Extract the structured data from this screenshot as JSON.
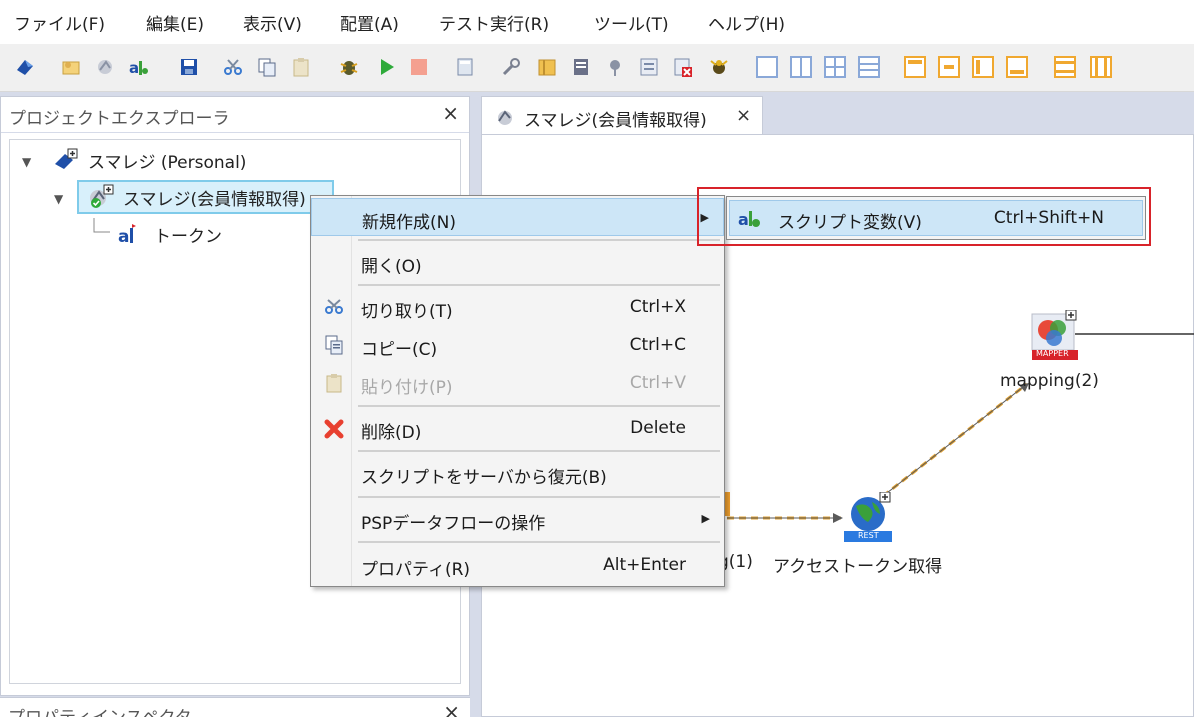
{
  "menubar": {
    "items": [
      "ファイル(F)",
      "編集(E)",
      "表示(V)",
      "配置(A)",
      "テスト実行(R)",
      "ツール(T)",
      "ヘルプ(H)"
    ]
  },
  "left_panel": {
    "title": "プロジェクトエクスプローラ",
    "close": "×",
    "tree": {
      "root": "スマレジ (Personal)",
      "child": "スマレジ(会員情報取得)",
      "leaf": "トークン"
    }
  },
  "bottom_panel": {
    "title": "プロパティインスペクタ",
    "close": "×"
  },
  "editor": {
    "tab_label": "スマレジ(会員情報取得)",
    "tab_close": "×",
    "nodes": {
      "mapping2": "mapping(2)",
      "mapping1_partial": "g(1)",
      "access_token": "アクセストークン取得",
      "mapper_badge": "MAPPER",
      "rest_badge": "REST"
    }
  },
  "context_menu": {
    "items": [
      {
        "label": "新規作成(N)",
        "shortcut": "",
        "submenu": true,
        "highlighted": true,
        "disabled": false
      },
      {
        "label": "開く(O)",
        "shortcut": "",
        "submenu": false,
        "highlighted": false,
        "disabled": false
      },
      {
        "label": "切り取り(T)",
        "shortcut": "Ctrl+X",
        "submenu": false,
        "highlighted": false,
        "disabled": false,
        "icon": "scissors-icon"
      },
      {
        "label": "コピー(C)",
        "shortcut": "Ctrl+C",
        "submenu": false,
        "highlighted": false,
        "disabled": false,
        "icon": "copy-icon"
      },
      {
        "label": "貼り付け(P)",
        "shortcut": "Ctrl+V",
        "submenu": false,
        "highlighted": false,
        "disabled": true,
        "icon": "paste-icon"
      },
      {
        "label": "削除(D)",
        "shortcut": "Delete",
        "submenu": false,
        "highlighted": false,
        "disabled": false,
        "icon": "delete-icon"
      },
      {
        "label": "スクリプトをサーバから復元(B)",
        "shortcut": "",
        "submenu": false,
        "highlighted": false,
        "disabled": false
      },
      {
        "label": "PSPデータフローの操作",
        "shortcut": "",
        "submenu": true,
        "highlighted": false,
        "disabled": false
      },
      {
        "label": "プロパティ(R)",
        "shortcut": "Alt+Enter",
        "submenu": false,
        "highlighted": false,
        "disabled": false
      }
    ]
  },
  "submenu": {
    "label": "スクリプト変数(V)",
    "shortcut": "Ctrl+Shift+N",
    "icon": "script-variable-icon"
  },
  "colors": {
    "highlight_bg": "#cde6f7",
    "annotation_red": "#d8232a",
    "flow_line": "#e0a030",
    "selection_border": "#7fcbea"
  }
}
